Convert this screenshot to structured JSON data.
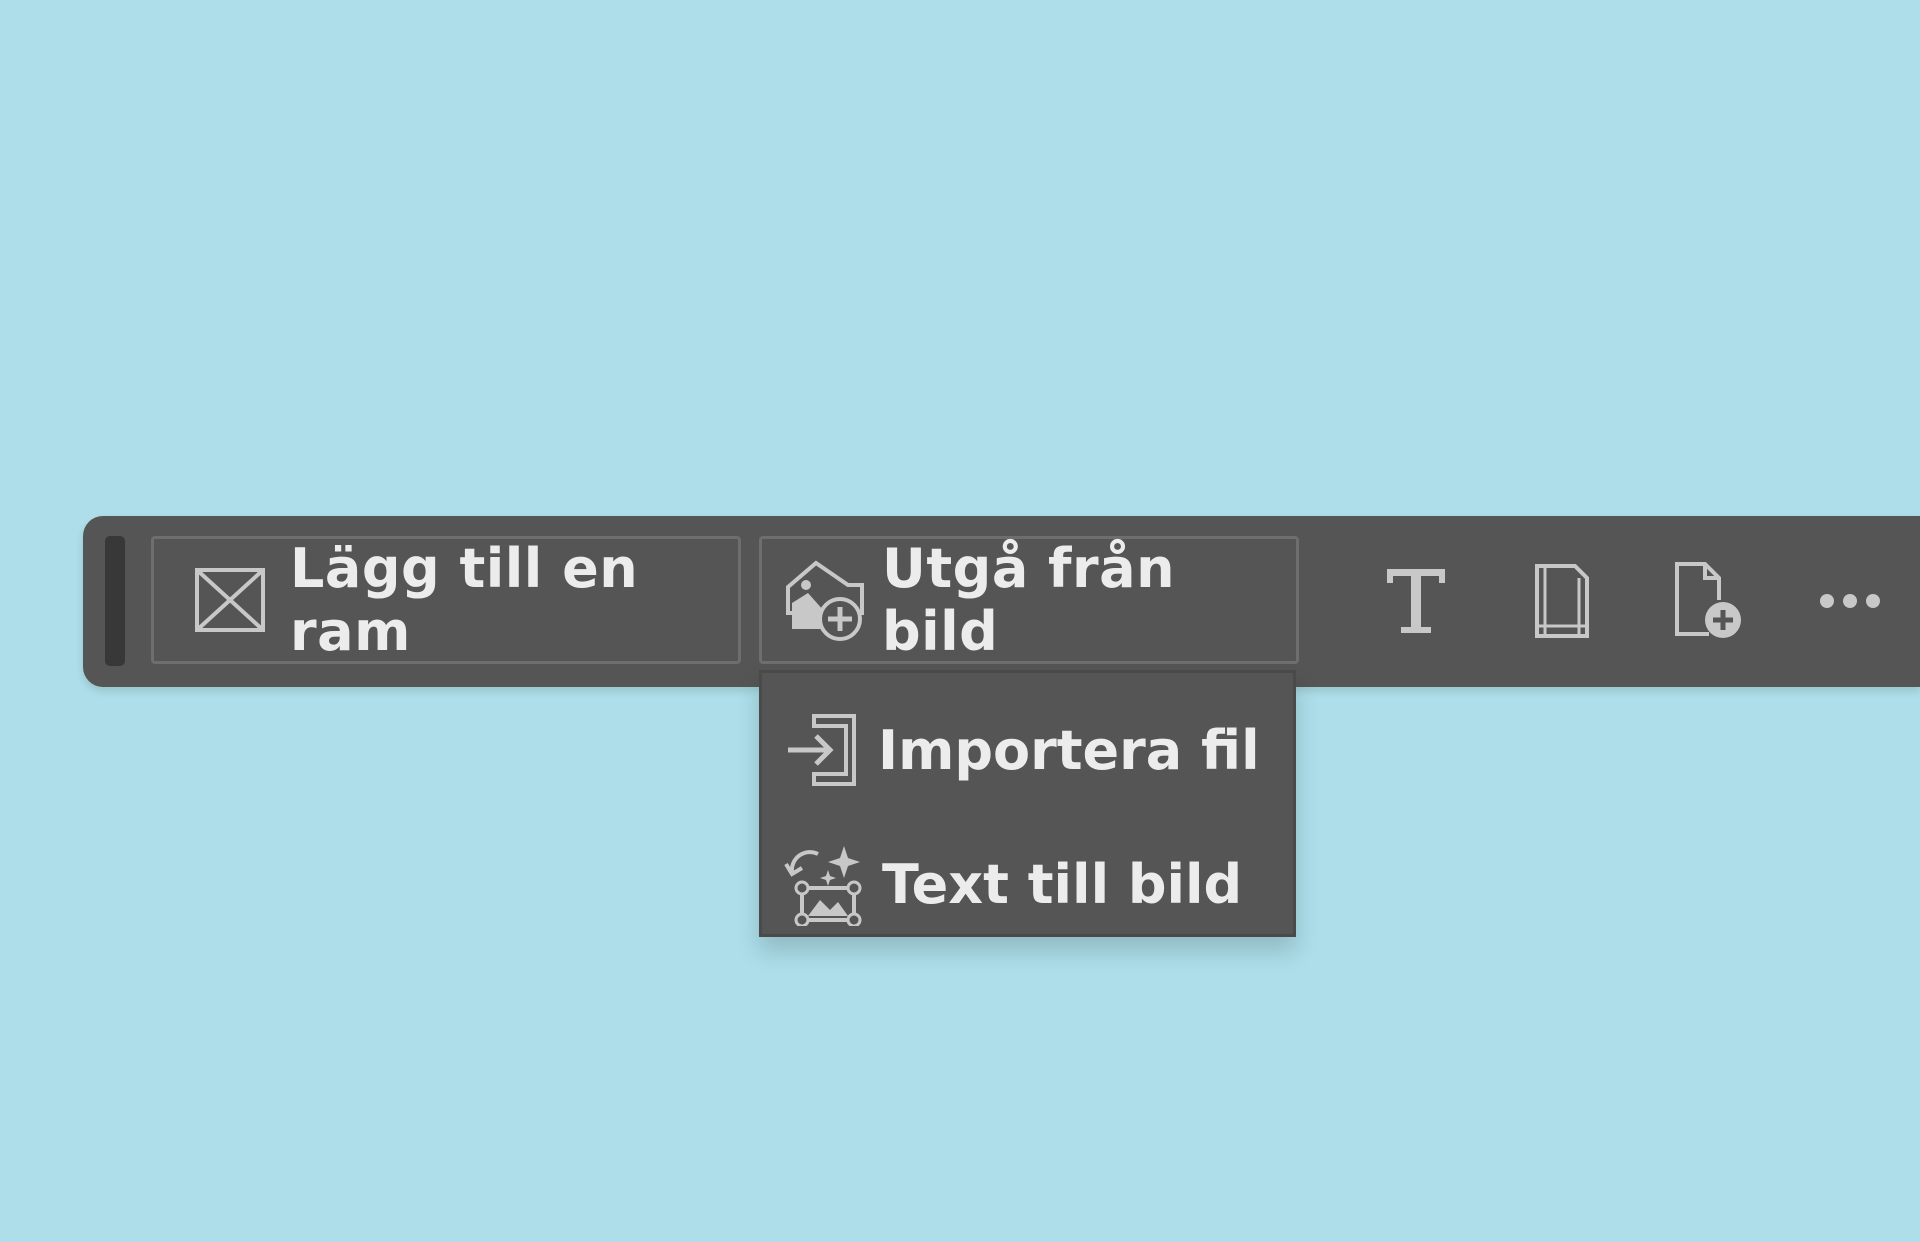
{
  "toolbar": {
    "add_frame_label": "Lägg till en ram",
    "start_from_image_label": "Utgå från bild",
    "icons": [
      "frame-icon",
      "image-add-icon",
      "text-tool-icon",
      "page-icon",
      "add-page-icon",
      "more-icon"
    ]
  },
  "dropdown": {
    "items": [
      {
        "label": "Importera fil",
        "icon": "import-file-icon"
      },
      {
        "label": "Text till bild",
        "icon": "text-to-image-icon"
      }
    ]
  },
  "colors": {
    "background": "#addee9",
    "toolbar": "#555555",
    "text": "#ececec",
    "icon": "#c8c8c8"
  }
}
